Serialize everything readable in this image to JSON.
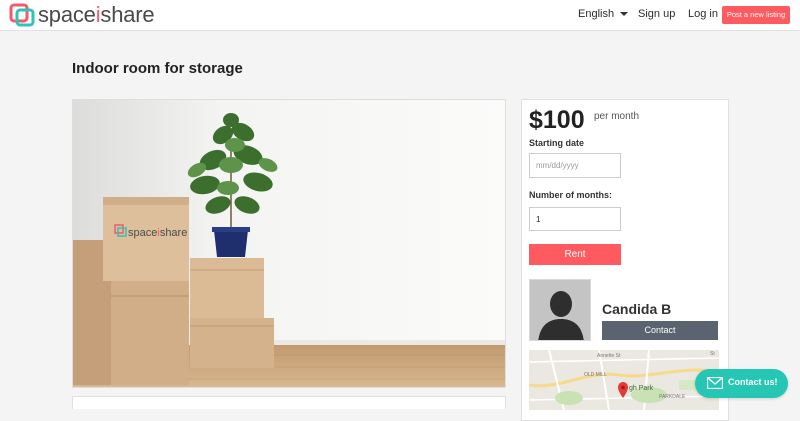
{
  "header": {
    "logo_text_a": "space",
    "logo_text_b": "i",
    "logo_text_c": "share",
    "language": "English",
    "signup": "Sign up",
    "login": "Log in",
    "post_listing": "Post a new listing"
  },
  "listing": {
    "title": "Indoor room for storage",
    "box_logo_a": "space",
    "box_logo_b": "i",
    "box_logo_c": "share"
  },
  "booking": {
    "price": "$100",
    "period": "per month",
    "start_label": "Starting date",
    "start_placeholder": "mm/dd/yyyy",
    "months_label": "Number of months:",
    "months_value": "1",
    "rent_button": "Rent"
  },
  "host": {
    "name": "Candida B",
    "contact_button": "Contact"
  },
  "map": {
    "labels": [
      "Annette St",
      "St",
      "OLD MILL",
      "gh Park",
      "PARKDALE"
    ]
  },
  "chat": {
    "label": "Contact us!"
  },
  "colors": {
    "accent": "#ff5a5f",
    "teal": "#26c6b5",
    "contact_gray": "#5a6470"
  },
  "icons": {
    "logo": "spaceishare-logo-icon",
    "caret": "caret-down-icon",
    "avatar": "person-silhouette-icon",
    "map_pin": "map-pin-icon",
    "chat": "envelope-icon"
  }
}
